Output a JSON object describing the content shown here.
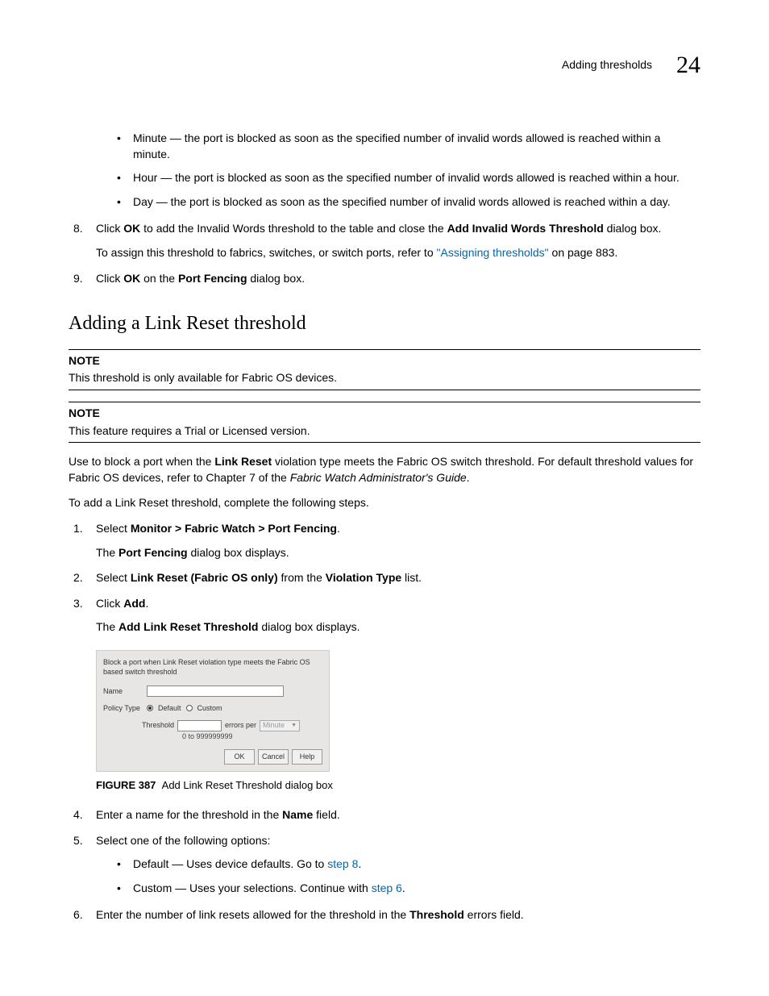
{
  "header": {
    "title": "Adding thresholds",
    "chapter": "24"
  },
  "top_bullets": [
    "Minute — the port is blocked as soon as the specified number of invalid words allowed is reached within a minute.",
    "Hour — the port is blocked as soon as the specified number of invalid words allowed is reached within a hour.",
    "Day — the port is blocked as soon as the specified number of invalid words allowed is reached within a day."
  ],
  "step8": {
    "num": "8.",
    "pre": "Click ",
    "ok": "OK",
    "mid": " to add the Invalid Words threshold to the table and close the ",
    "dlg": "Add Invalid Words Threshold",
    "post": " dialog box.",
    "assign_pre": "To assign this threshold to fabrics, switches, or switch ports, refer to ",
    "assign_link": "\"Assigning thresholds\"",
    "assign_post": " on page 883."
  },
  "step9": {
    "num": "9.",
    "pre": "Click ",
    "ok": "OK",
    "mid": " on the ",
    "dlg": "Port Fencing",
    "post": " dialog box."
  },
  "section_heading": "Adding a Link Reset threshold",
  "note1_label": "NOTE",
  "note1_text": "This threshold is only available for Fabric OS devices.",
  "note2_label": "NOTE",
  "note2_text": "This feature requires a Trial or Licensed version.",
  "intro": {
    "pre": "Use to block a port when the ",
    "bold1": "Link Reset",
    "mid": " violation type meets the Fabric OS switch threshold. For default threshold values for Fabric OS devices, refer to Chapter 7 of the ",
    "italic": "Fabric Watch Administrator's Guide",
    "post": "."
  },
  "intro2": "To add a Link Reset threshold, complete the following steps.",
  "s1": {
    "num": "1.",
    "pre": "Select ",
    "bold": "Monitor > Fabric Watch > Port Fencing",
    "post": ".",
    "sub_pre": "The ",
    "sub_bold": "Port Fencing",
    "sub_post": " dialog box displays."
  },
  "s2": {
    "num": "2.",
    "pre": "Select ",
    "bold1": "Link Reset (Fabric OS only)",
    "mid": " from the ",
    "bold2": "Violation Type",
    "post": " list."
  },
  "s3": {
    "num": "3.",
    "pre": "Click ",
    "bold": "Add",
    "post": ".",
    "sub_pre": "The ",
    "sub_bold": "Add Link Reset Threshold",
    "sub_post": " dialog box displays."
  },
  "dialog": {
    "instruction": "Block a port when Link Reset violation type meets the Fabric OS based switch threshold",
    "name_label": "Name",
    "policy_label": "Policy Type",
    "default_label": "Default",
    "custom_label": "Custom",
    "threshold_label": "Threshold",
    "errors_per": "errors per",
    "time_unit": "Minute",
    "range_hint": "0 to 999999999",
    "btn_ok": "OK",
    "btn_cancel": "Cancel",
    "btn_help": "Help"
  },
  "figure": {
    "label": "FIGURE 387",
    "caption": "Add Link Reset Threshold dialog box"
  },
  "s4": {
    "num": "4.",
    "pre": "Enter a name for the threshold in the ",
    "bold": "Name",
    "post": " field."
  },
  "s5": {
    "num": "5.",
    "text": "Select one of the following options:",
    "opt_default_pre": "Default — Uses device defaults. Go to ",
    "opt_default_link": "step 8",
    "opt_default_post": ".",
    "opt_custom_pre": "Custom — Uses your selections. Continue with ",
    "opt_custom_link": "step 6",
    "opt_custom_post": "."
  },
  "s6": {
    "num": "6.",
    "pre": "Enter the number of link resets allowed for the threshold in the ",
    "bold": "Threshold",
    "post": " errors field."
  }
}
